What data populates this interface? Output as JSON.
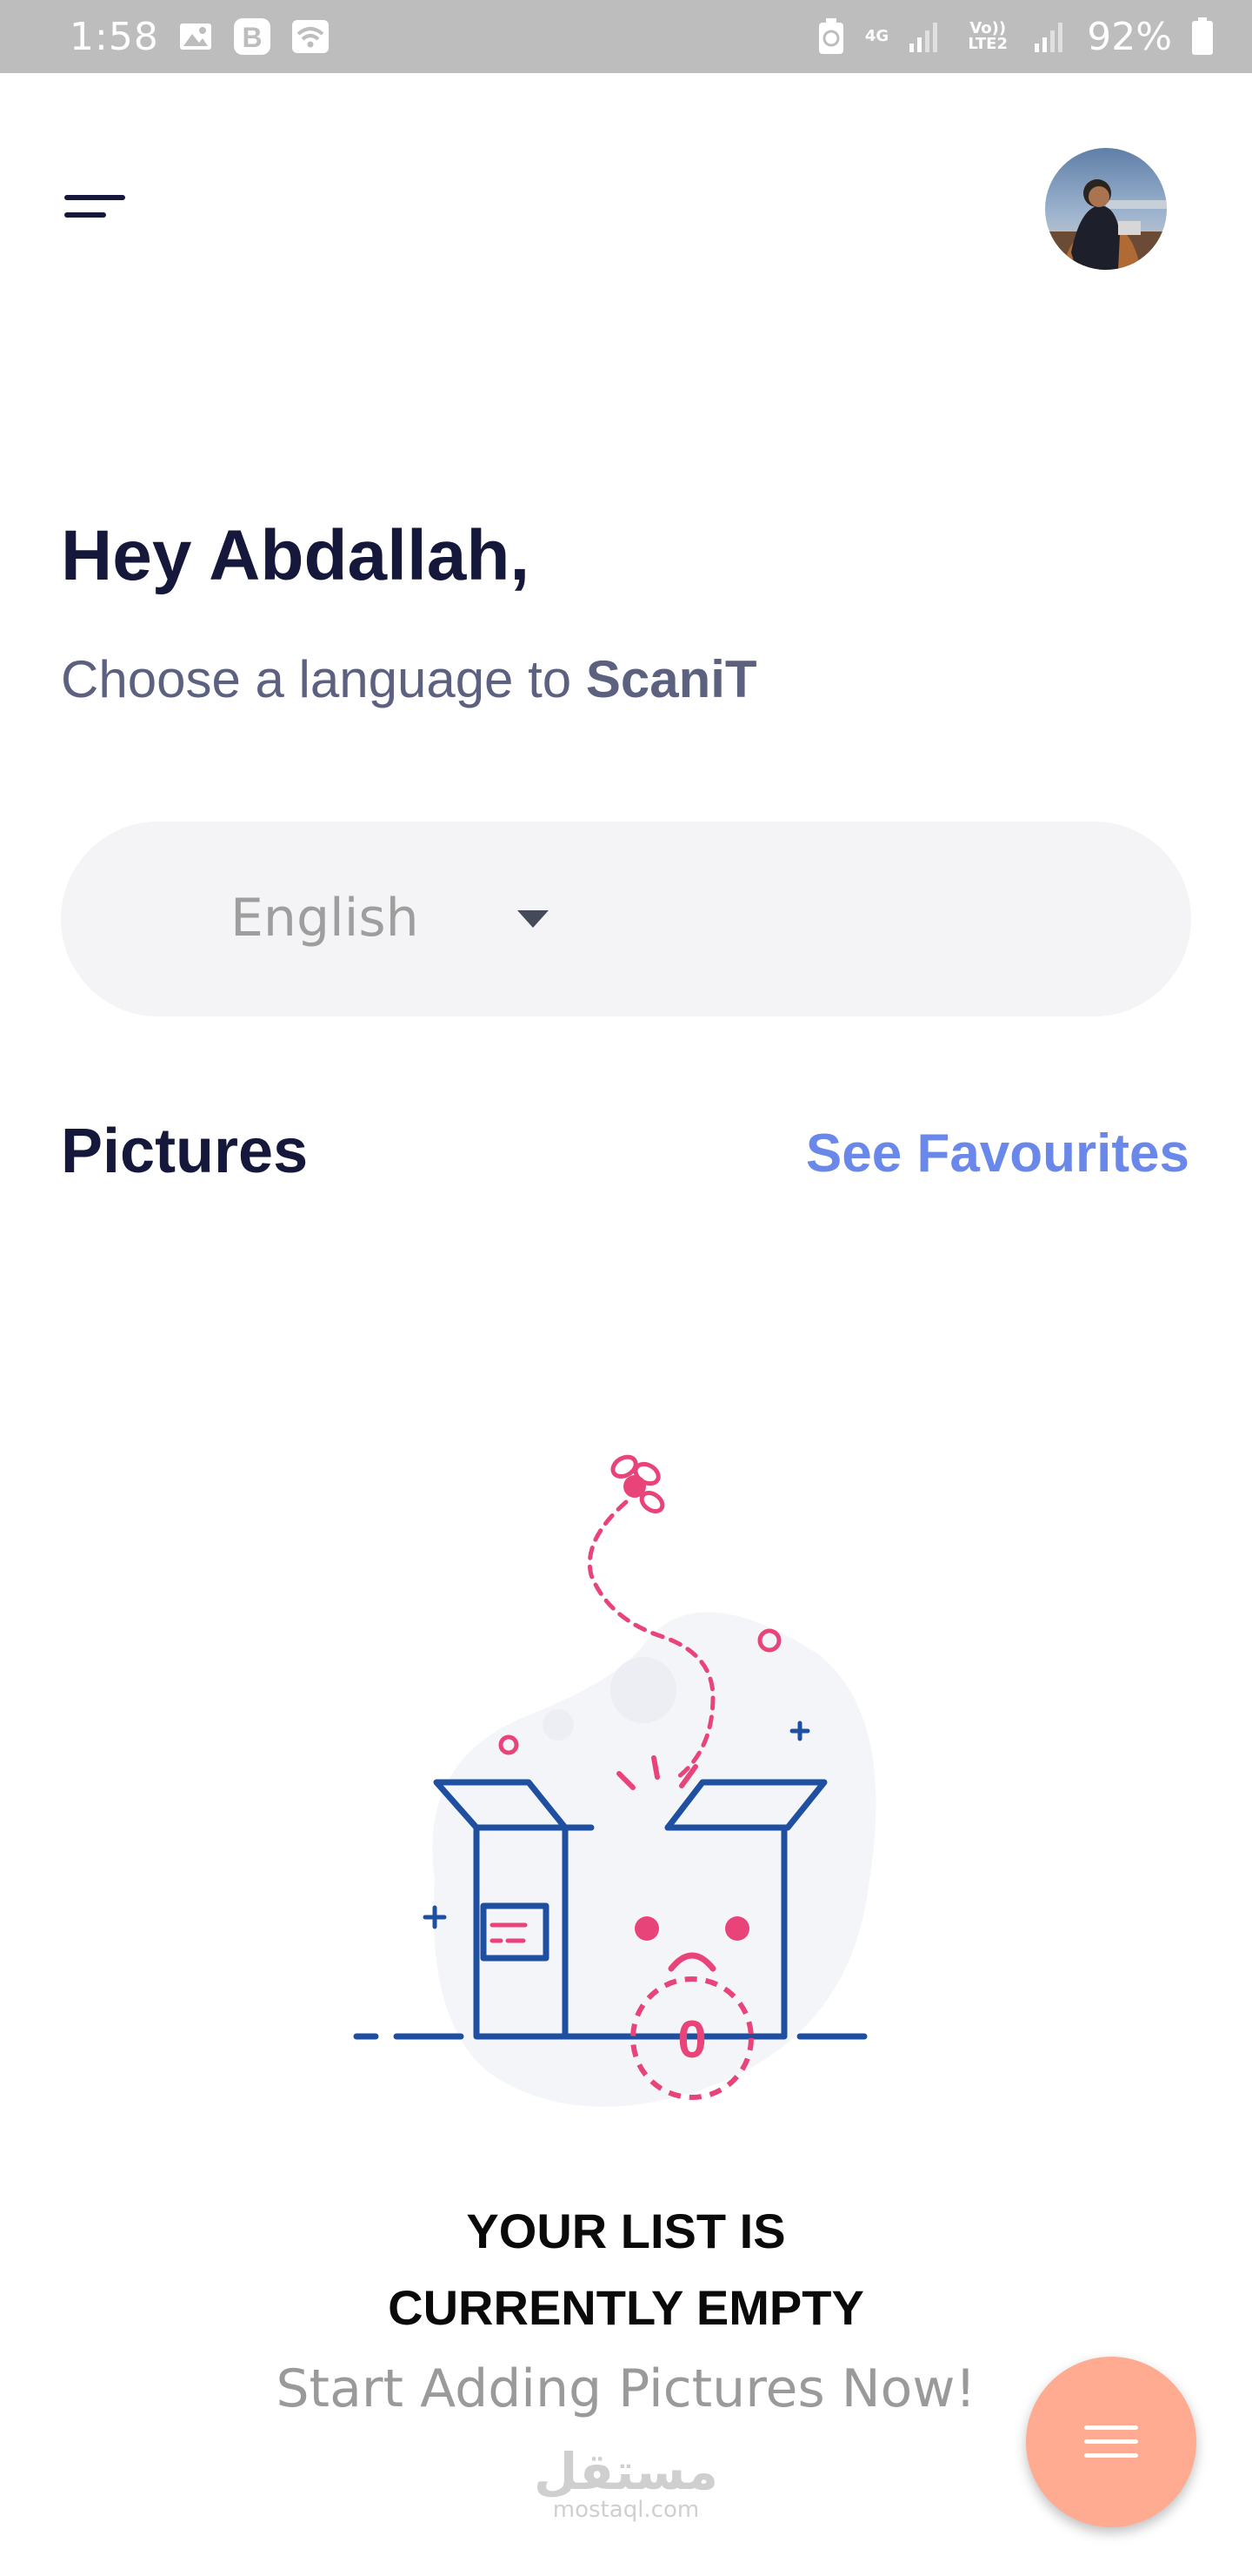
{
  "status_bar": {
    "time": "1:58",
    "left_icons": [
      "gallery-icon",
      "b-app-icon",
      "wifi-icon"
    ],
    "network_label": "4G",
    "volte_label": "Vo)) LTE2",
    "battery": "92%"
  },
  "header": {
    "menu_icon": "menu-lines-icon",
    "avatar": "user-avatar"
  },
  "greeting": {
    "title": "Hey Abdallah,",
    "subtitle_prefix": "Choose a language to ",
    "app_name": "ScaniT"
  },
  "language_select": {
    "value": "English",
    "icon": "caret-down-icon"
  },
  "pictures": {
    "title": "Pictures",
    "see_favourites": "See Favourites"
  },
  "empty_state": {
    "illustration": "empty-box-illustration",
    "count": "0",
    "title_line1": "YOUR LIST IS",
    "title_line2": "CURRENTLY EMPTY",
    "subtitle": "Start Adding Pictures Now!"
  },
  "watermark": {
    "arabic": "مستقل",
    "latin": "mostaql.com"
  },
  "fab": {
    "icon": "hamburger-icon"
  },
  "colors": {
    "status_bar": "#bdbdbd",
    "title": "#15183a",
    "subtitle": "#5c6180",
    "accent_link": "#6a87ea",
    "select_bg": "#f4f4f6",
    "fab": "#ffab91",
    "illustration_blue": "#1e4fa0",
    "illustration_pink": "#e8447a"
  }
}
